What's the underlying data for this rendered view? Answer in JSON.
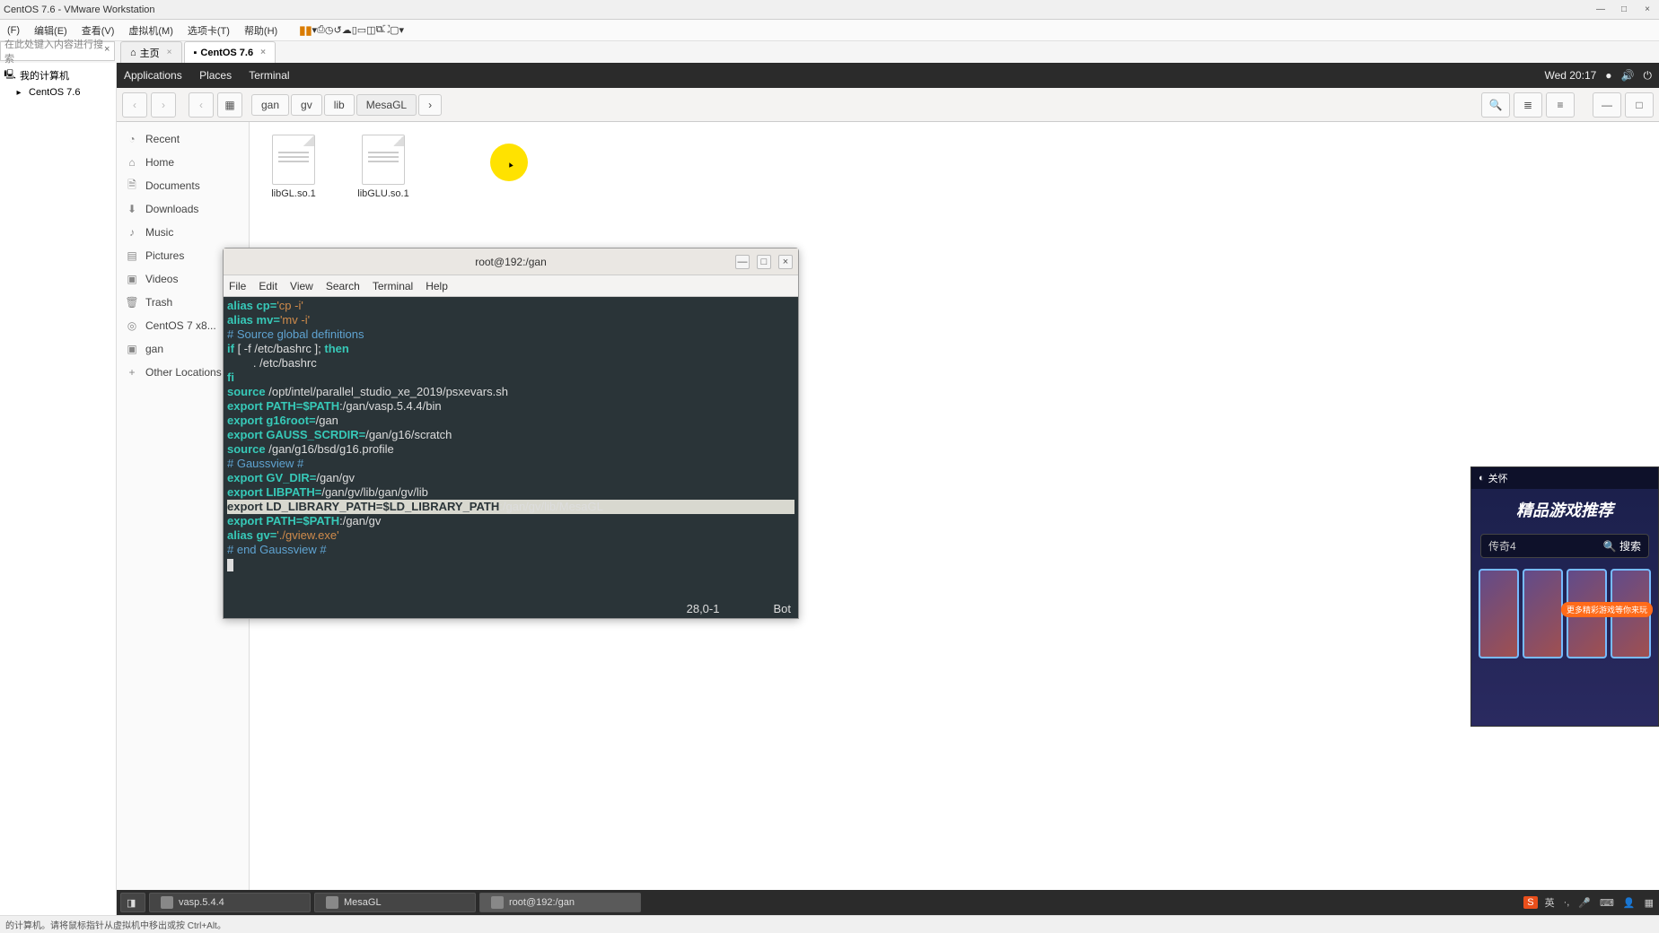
{
  "vmware": {
    "title": "CentOS 7.6 - VMware Workstation",
    "menu": [
      "(F)",
      "编辑(E)",
      "查看(V)",
      "虚拟机(M)",
      "选项卡(T)",
      "帮助(H)"
    ],
    "search_placeholder": "在此处键入内容进行搜索",
    "tabs": {
      "home": "主页",
      "active": "CentOS 7.6"
    },
    "tree": {
      "root": "我的计算机",
      "child": "CentOS 7.6"
    },
    "status": "的计算机。请将鼠标指针从虚拟机中移出或按 Ctrl+Alt。"
  },
  "gnome": {
    "top": {
      "apps": "Applications",
      "places": "Places",
      "terminal": "Terminal",
      "clock": "Wed 20:17"
    },
    "bottom": {
      "tasks": [
        "vasp.5.4.4",
        "MesaGL",
        "root@192:/gan"
      ],
      "tray_lang": "英"
    }
  },
  "nautilus": {
    "breadcrumbs": [
      "gan",
      "gv",
      "lib",
      "MesaGL"
    ],
    "sidebar": [
      "Recent",
      "Home",
      "Documents",
      "Downloads",
      "Music",
      "Pictures",
      "Videos",
      "Trash",
      "CentOS 7 x8...",
      "gan",
      "Other Locations"
    ],
    "files": [
      "libGL.so.1",
      "libGLU.so.1"
    ]
  },
  "terminal": {
    "title": "root@192:/gan",
    "menu": [
      "File",
      "Edit",
      "View",
      "Search",
      "Terminal",
      "Help"
    ],
    "lines": {
      "l1_alias": "alias",
      "l1_cp": "cp=",
      "l1_str": "'cp -i'",
      "l2_alias": "alias",
      "l2_mv": "mv=",
      "l2_str": "'mv -i'",
      "l3": "",
      "l4": "# Source global definitions",
      "l5_if": "if",
      "l5_cond": " [ -f /etc/bashrc ]; ",
      "l5_then": "then",
      "l6": "        . /etc/bashrc",
      "l7": "fi",
      "l8": "",
      "l9_src": "source",
      "l9_path": " /opt/intel/parallel_studio_xe_2019/psxevars.sh",
      "l10_exp": "export",
      "l10_var": " PATH=$PATH",
      "l10_path": ":/gan/vasp.5.4.4/bin",
      "l11": "",
      "l12_exp": "export",
      "l12_var": " g16root=",
      "l12_path": "/gan",
      "l13_exp": "export",
      "l13_var": " GAUSS_SCRDIR=",
      "l13_path": "/gan/g16/scratch",
      "l14_src": "source",
      "l14_path": " /gan/g16/bsd/g16.profile",
      "l15": "",
      "l16": "# Gaussview #",
      "l17_exp": "export",
      "l17_var": " GV_DIR=",
      "l17_path": "/gan/gv",
      "l18_exp": "export",
      "l18_var": " LIBPATH=",
      "l18_path": "/gan/gv/lib/gan/gv/lib",
      "l19_exp": "export",
      "l19_var": " LD_LIBRARY_PATH=",
      "l19_sel": "$LD_LIBRARY_PATH",
      "l19_path": ":/gan/gv/lib/MesaGL",
      "l20_exp": "export",
      "l20_var": " PATH=$PATH",
      "l20_path": ":/gan/gv",
      "l21_alias": "alias",
      "l21_gv": " gv=",
      "l21_str": "'./gview.exe'",
      "l22": "# end Gaussview #"
    },
    "status_pos": "28,0-1",
    "status_right": "Bot"
  },
  "ad": {
    "titlebar": "关怀",
    "headline": "精品游戏推荐",
    "search_value": "传奇4",
    "search_btn": "搜索",
    "banner": "更多精彩游戏等你来玩"
  }
}
